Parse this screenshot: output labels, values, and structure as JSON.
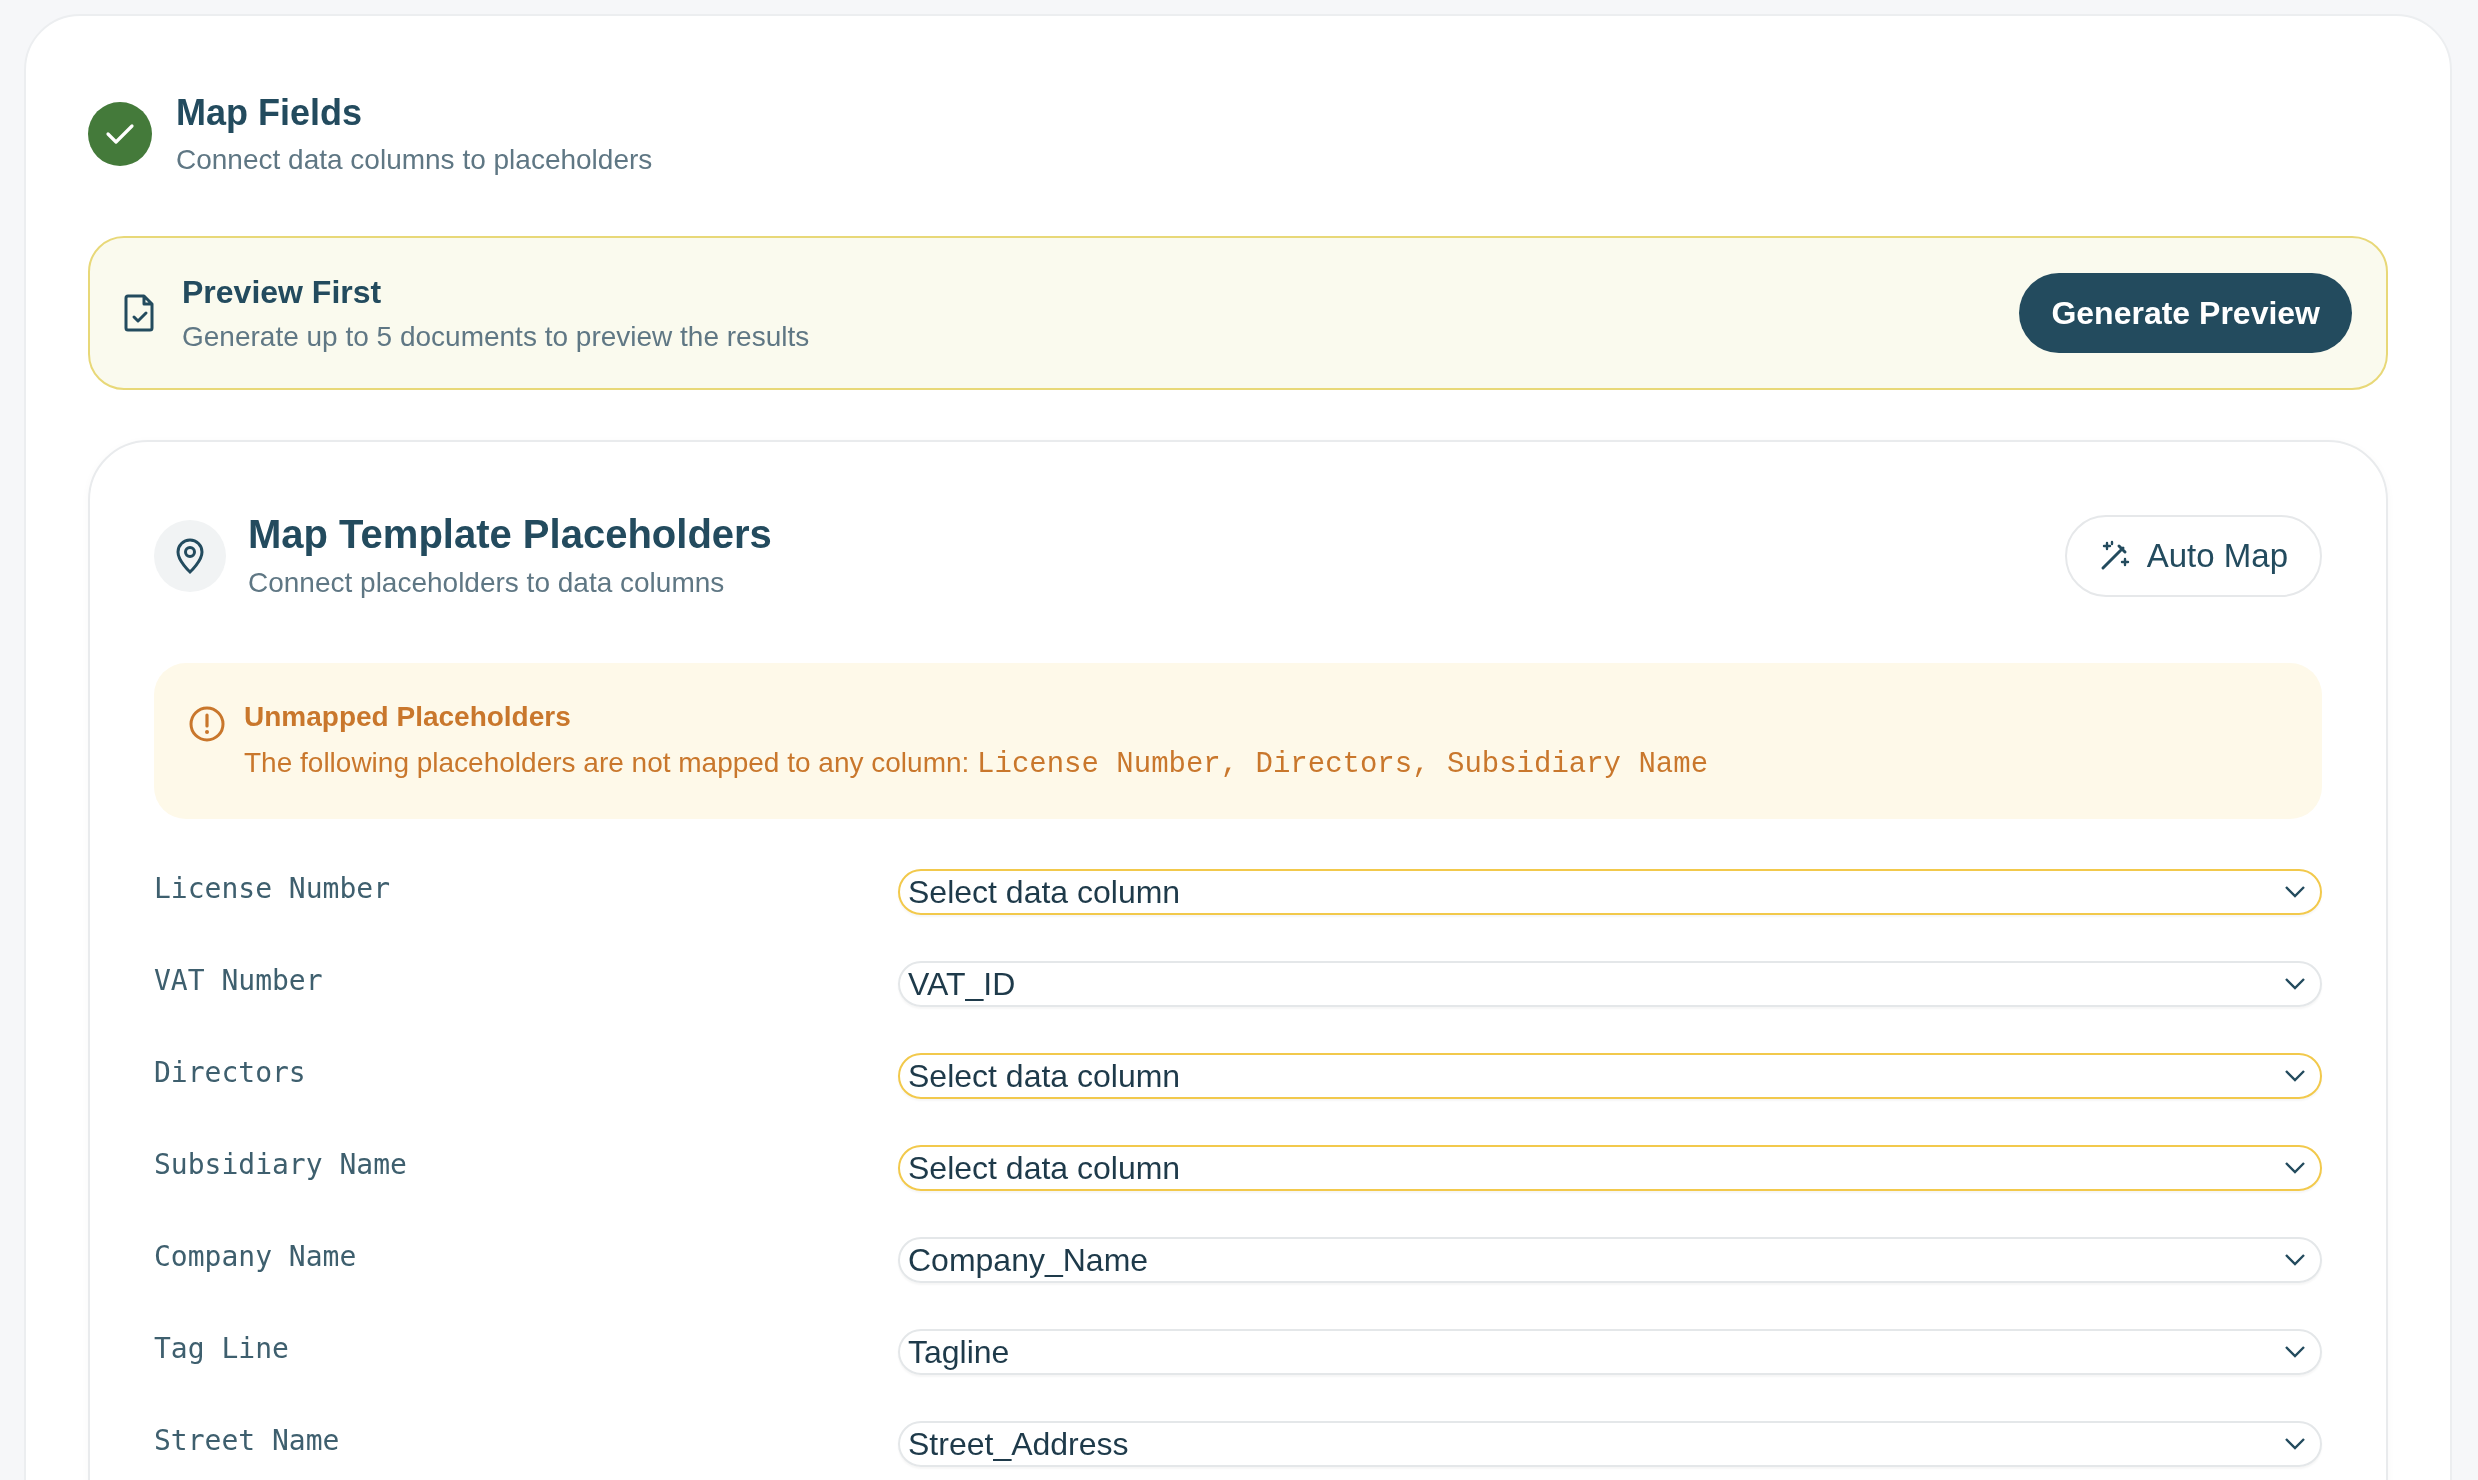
{
  "step": {
    "title": "Map Fields",
    "subtitle": "Connect data columns to placeholders",
    "completed": true
  },
  "preview": {
    "title": "Preview First",
    "description": "Generate up to 5 documents to preview the results",
    "button": "Generate Preview"
  },
  "mapping": {
    "title": "Map Template Placeholders",
    "subtitle": "Connect placeholders to data columns",
    "auto_map_button": "Auto Map",
    "warning": {
      "title": "Unmapped Placeholders",
      "message": "The following placeholders are not mapped to any column:",
      "placeholders": "License Number, Directors, Subsidiary Name"
    },
    "rows": [
      {
        "label": "License Number",
        "value": "Select data column",
        "mapped": false
      },
      {
        "label": "VAT Number",
        "value": "VAT_ID",
        "mapped": true
      },
      {
        "label": "Directors",
        "value": "Select data column",
        "mapped": false
      },
      {
        "label": "Subsidiary Name",
        "value": "Select data column",
        "mapped": false
      },
      {
        "label": "Company Name",
        "value": "Company_Name",
        "mapped": true
      },
      {
        "label": "Tag Line",
        "value": "Tagline",
        "mapped": true
      },
      {
        "label": "Street Name",
        "value": "Street_Address",
        "mapped": true
      }
    ]
  }
}
